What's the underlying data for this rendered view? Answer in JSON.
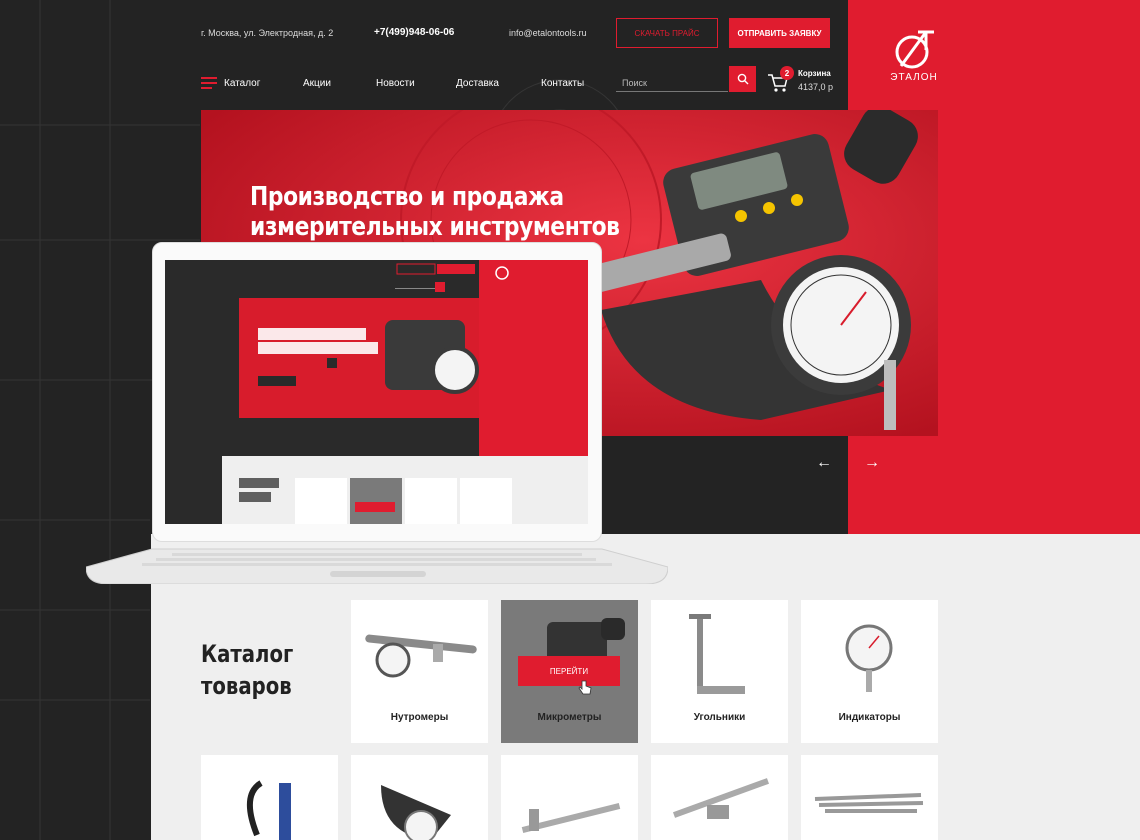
{
  "header": {
    "address": "г. Москва, ул. Электродная, д. 2",
    "phone": "+7(499)948-06-06",
    "email": "info@etalontools.ru",
    "download_price_label": "СКАЧАТЬ ПРАЙС",
    "send_request_label": "ОТПРАВИТЬ ЗАЯВКУ",
    "logo_text": "ЭТАЛОН"
  },
  "nav": {
    "items": [
      {
        "label": "Каталог"
      },
      {
        "label": "Акции"
      },
      {
        "label": "Новости"
      },
      {
        "label": "Доставка"
      },
      {
        "label": "Контакты"
      }
    ],
    "search_placeholder": "Поиск",
    "cart_label": "Корзина",
    "cart_count": "2",
    "cart_sum": "4137,0 р"
  },
  "hero": {
    "title_line1": "Производство и продажа",
    "title_line2": "измерительных инструментов"
  },
  "slider": {
    "prev": "←",
    "next": "→"
  },
  "catalog": {
    "title_line1": "Каталог",
    "title_line2": "товаров",
    "go_label": "ПЕРЕЙТИ",
    "cards": [
      {
        "name": "Нутромеры"
      },
      {
        "name": "Микрометры"
      },
      {
        "name": "Угольники"
      },
      {
        "name": "Индикаторы"
      }
    ]
  },
  "colors": {
    "accent": "#e01c2f",
    "dark_bg": "#232323",
    "light_bg": "#efefef"
  }
}
